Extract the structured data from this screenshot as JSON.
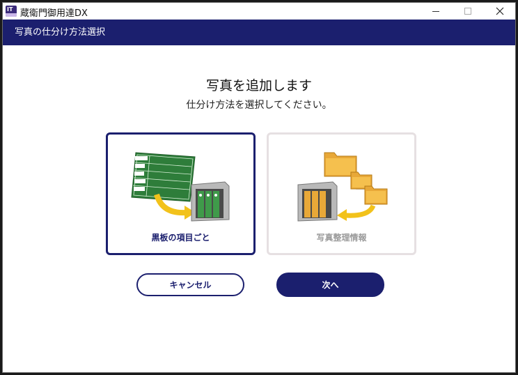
{
  "window": {
    "title": "蔵衛門御用達DX",
    "icon": "app-logo-icon",
    "controls": [
      "minimize-icon",
      "maximize-icon",
      "close-icon"
    ]
  },
  "header": {
    "title": "写真の仕分け方法選択"
  },
  "main": {
    "heading": "写真を追加します",
    "subheading": "仕分け方法を選択してください。",
    "options": [
      {
        "label": "黒板の項目ごと",
        "selected": true
      },
      {
        "label": "写真整理情報",
        "selected": false
      }
    ]
  },
  "buttons": {
    "cancel_label": "キャンセル",
    "next_label": "次へ"
  },
  "colors": {
    "accent": "#1b1f6e",
    "folder": "#e8a838",
    "board": "#2e7d3a"
  }
}
